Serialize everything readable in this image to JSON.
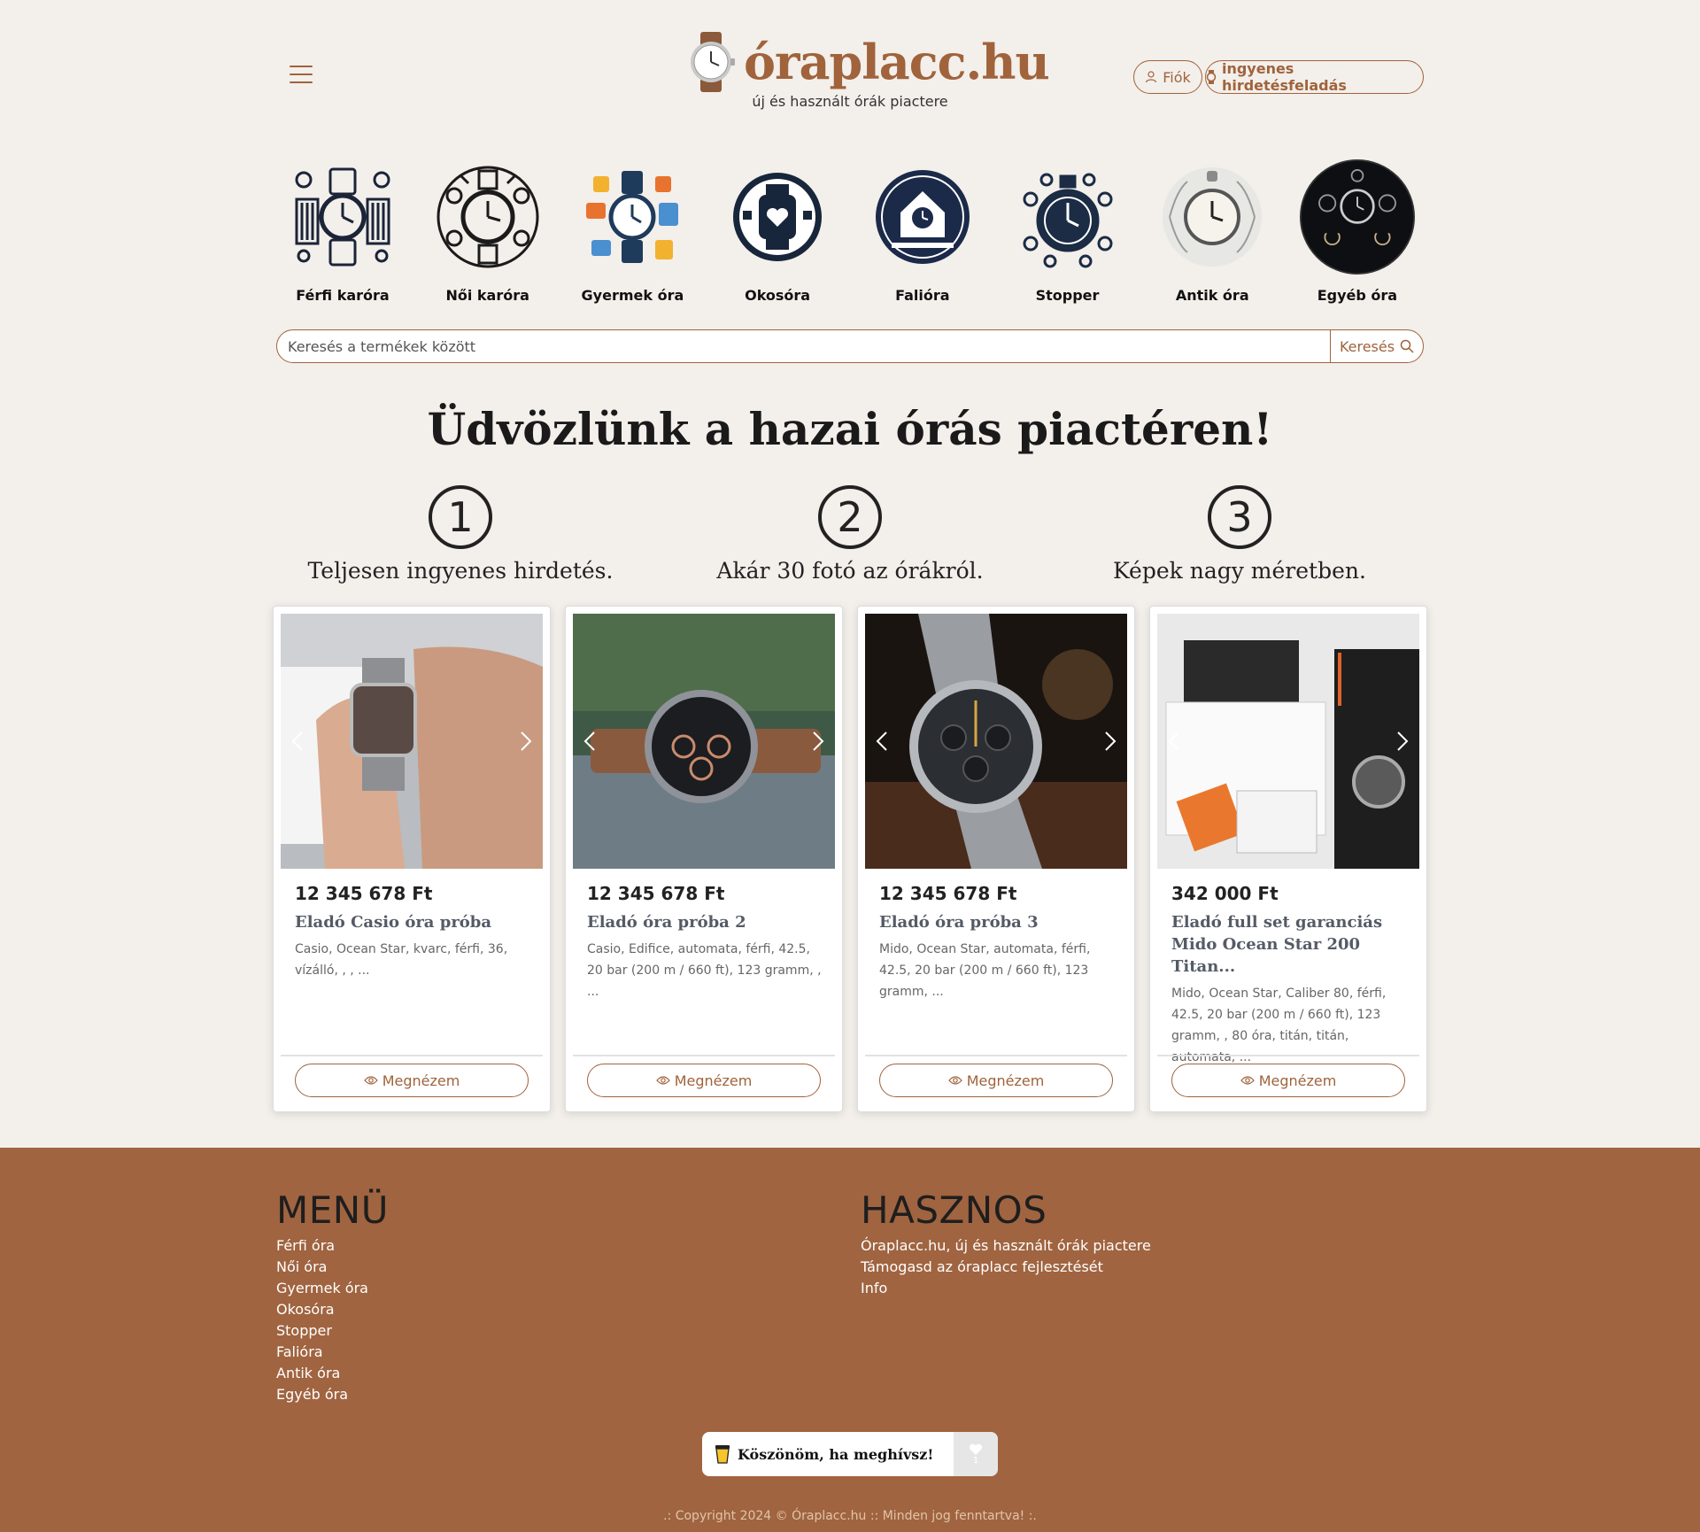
{
  "header": {
    "logo_text": "óraplacc.hu",
    "tagline": "új és használt órák piactere",
    "account_label": "Fiók",
    "post_ad_label": "ingyenes hirdetésfeladás"
  },
  "categories": [
    {
      "label": "Férfi karóra",
      "icon": "mens-watch-icon"
    },
    {
      "label": "Női karóra",
      "icon": "womens-watch-icon"
    },
    {
      "label": "Gyermek óra",
      "icon": "kids-watch-icon"
    },
    {
      "label": "Okosóra",
      "icon": "smartwatch-icon"
    },
    {
      "label": "Falióra",
      "icon": "wall-clock-icon"
    },
    {
      "label": "Stopper",
      "icon": "stopwatch-icon"
    },
    {
      "label": "Antik óra",
      "icon": "antique-watch-icon"
    },
    {
      "label": "Egyéb óra",
      "icon": "other-watch-icon"
    }
  ],
  "search": {
    "placeholder": "Keresés a termékek között",
    "button_label": "Keresés"
  },
  "welcome": {
    "title": "Üdvözlünk a hazai órás piactéren!",
    "steps": [
      {
        "number": "1",
        "text": "Teljesen ingyenes hirdetés."
      },
      {
        "number": "2",
        "text": "Akár 30 fotó az órákról."
      },
      {
        "number": "3",
        "text": "Képek nagy méretben."
      }
    ]
  },
  "listings": [
    {
      "price": "12 345 678 Ft",
      "title": "Eladó Casio óra próba",
      "desc": "Casio, Ocean Star, kvarc, férfi, 36, vízálló, , , ...",
      "button": "Megnézem"
    },
    {
      "price": "12 345 678 Ft",
      "title": "Eladó óra próba 2",
      "desc": "Casio, Edifice, automata, férfi, 42.5, 20 bar (200 m / 660 ft), 123 gramm, , ...",
      "button": "Megnézem"
    },
    {
      "price": "12 345 678 Ft",
      "title": "Eladó óra próba 3",
      "desc": "Mido, Ocean Star, automata, férfi, 42.5, 20 bar (200 m / 660 ft), 123 gramm, ...",
      "button": "Megnézem"
    },
    {
      "price": "342 000 Ft",
      "title": "Eladó full set garanciás Mido Ocean Star 200 Titan...",
      "desc": "Mido, Ocean Star, Caliber 80, férfi, 42.5, 20 bar (200 m / 660 ft), 123 gramm, , 80 óra, titán, titán, automata, ...",
      "button": "Megnézem"
    }
  ],
  "footer": {
    "menu_title": "MENÜ",
    "menu_items": [
      "Férfi óra",
      "Női óra",
      "Gyermek óra",
      "Okosóra",
      "Stopper",
      "Falióra",
      "Antik óra",
      "Egyéb óra"
    ],
    "useful_title": "HASZNOS",
    "useful_items": [
      "Óraplacc.hu, új és használt órák piactere",
      "Támogasd az óraplacc fejlesztését",
      "Info"
    ],
    "coffee_label": "Köszönöm, ha meghívsz!",
    "coffee_count": "1",
    "copyright": ".: Copyright 2024 © Óraplacc.hu :: Minden jog fenntartva! :."
  },
  "colors": {
    "brand": "#a0633c",
    "footer_bg": "#a06440",
    "page_bg": "#f3efeb"
  }
}
